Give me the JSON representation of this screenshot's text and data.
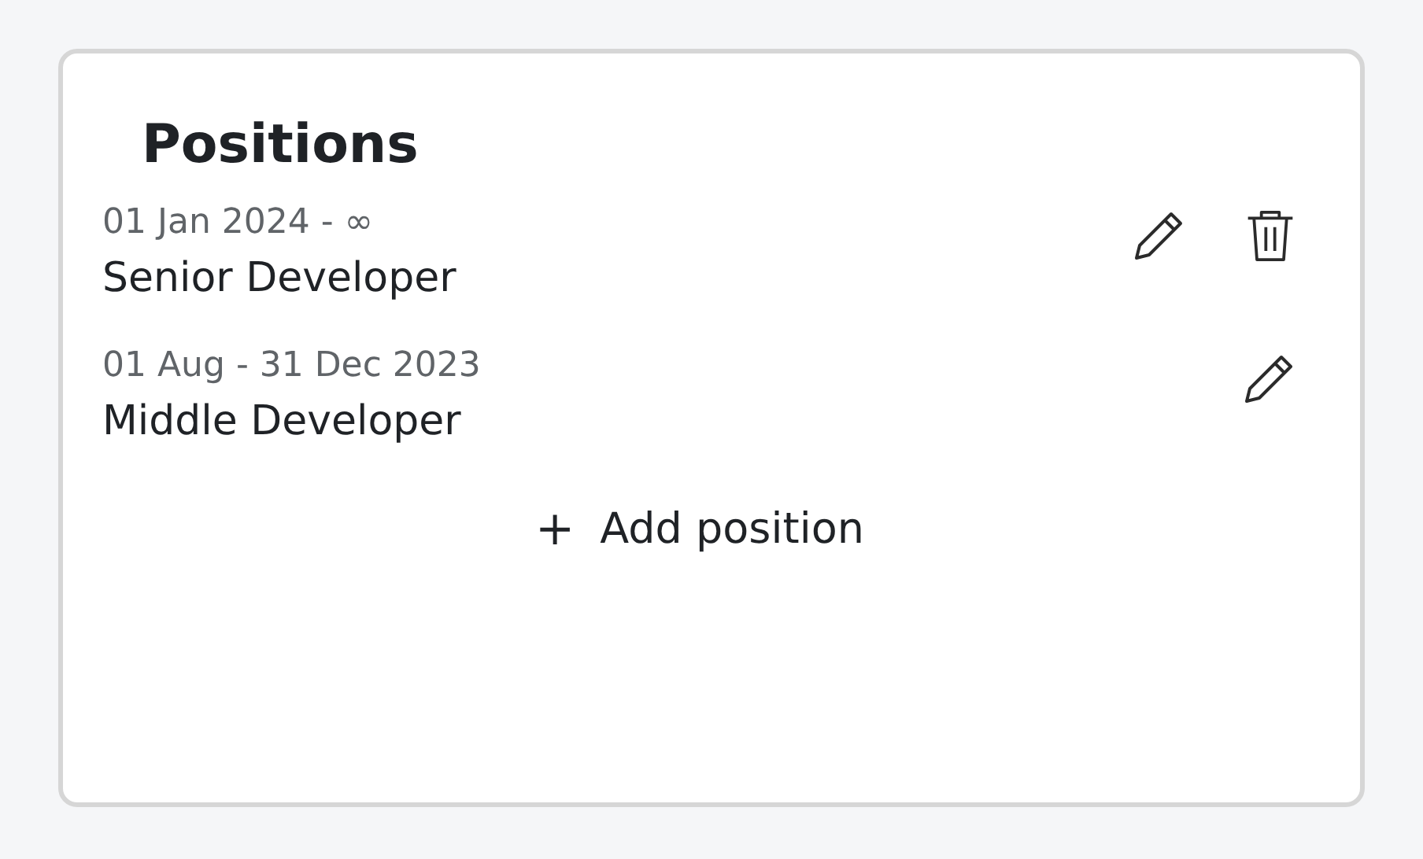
{
  "card": {
    "title": "Positions"
  },
  "positions": [
    {
      "period": "01 Jan 2024 - ∞",
      "title": "Senior Developer",
      "editable": true,
      "deletable": true
    },
    {
      "period": "01 Aug - 31 Dec 2023",
      "title": "Middle Developer",
      "editable": true,
      "deletable": false
    }
  ],
  "add_button": {
    "icon": "+",
    "label": "Add position"
  }
}
